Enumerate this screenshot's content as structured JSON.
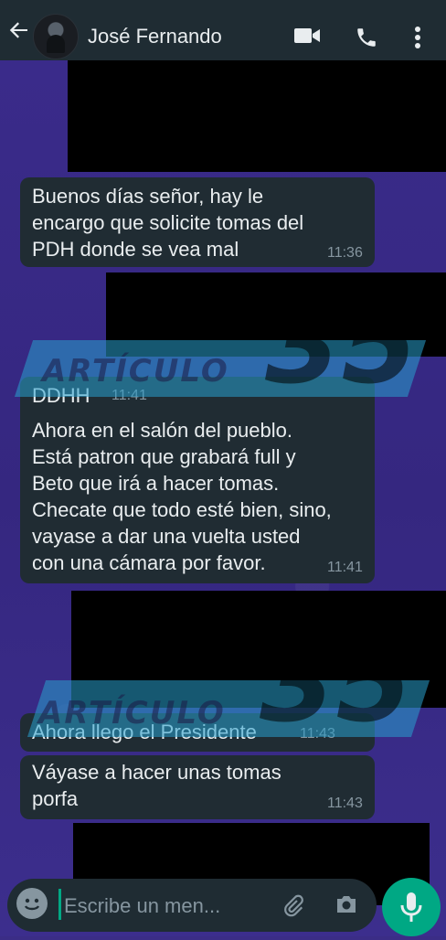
{
  "header": {
    "contact_name": "José Fernando",
    "icons": [
      "back-arrow-icon",
      "video-call-icon",
      "phone-icon",
      "more-options-icon"
    ]
  },
  "messages": [
    {
      "text_lines": [
        "Buenos días señor, hay le",
        "encargo que solicite tomas del",
        "PDH donde se vea mal"
      ],
      "time": "11:36"
    },
    {
      "text_lines": [
        "DDHH"
      ],
      "time": "11:41"
    },
    {
      "text_lines": [
        "Ahora en el salón del pueblo.",
        "Está patron que grabará full y",
        "Beto que irá a hacer tomas.",
        "Checate que todo esté bien, sino,",
        "vayase a dar una vuelta usted",
        "con una cámara por favor."
      ],
      "time": "11:41"
    },
    {
      "text_lines": [
        "Ahora llego el Presidente"
      ],
      "time": "11:43"
    },
    {
      "text_lines": [
        "Váyase a hacer unas tomas",
        "porfa"
      ],
      "time": "11:43"
    }
  ],
  "watermark": {
    "word": "ARTÍCULO",
    "number": "35"
  },
  "input": {
    "placeholder": "Escribe un men..."
  },
  "colors": {
    "header": "#1f2c33",
    "bubble": "#202c33",
    "accent": "#00a884",
    "wallpaper": "#3b2d86"
  }
}
